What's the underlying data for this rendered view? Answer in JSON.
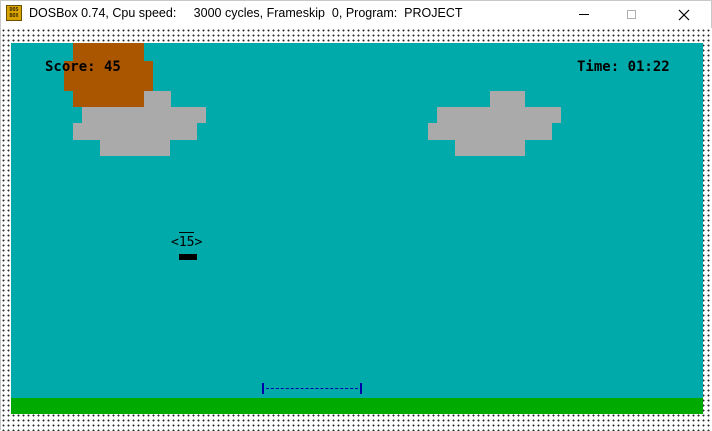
{
  "window": {
    "title": "DOSBox 0.74, Cpu speed:     3000 cycles, Frameskip  0, Program:  PROJECT",
    "icon_label_top": "DOS",
    "icon_label_bottom": "BOX",
    "icon_name": "dosbox-app-icon",
    "controls": {
      "minimize_icon": "minimize-icon",
      "maximize_icon": "maximize-icon",
      "close_icon": "close-icon",
      "close_glyph": "✕"
    }
  },
  "game": {
    "score_label": "Score: 45",
    "time_label": "Time: 01:22",
    "plane_label": "<15>",
    "colors": {
      "sky": "#00aaaa",
      "ground": "#00aa00",
      "sun": "#aa5500",
      "cloud": "#aaaaaa",
      "runway": "#0000aa",
      "text": "#000000"
    }
  }
}
